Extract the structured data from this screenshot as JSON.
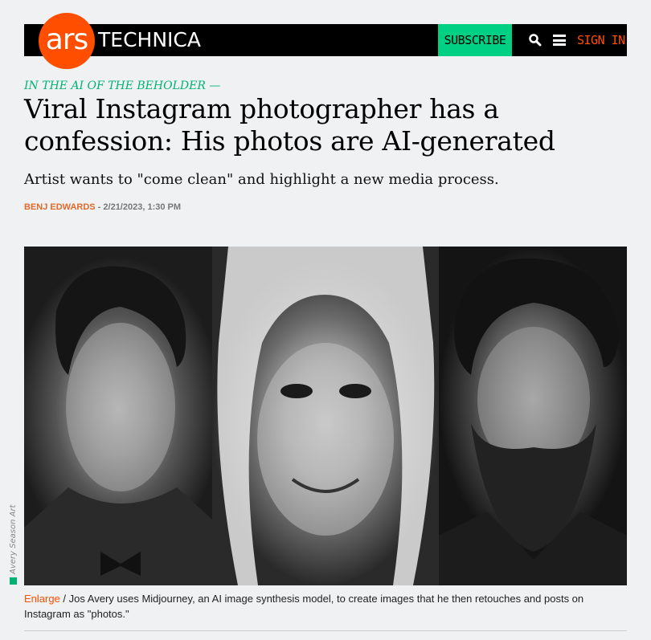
{
  "site": {
    "logo_ars": "ars",
    "logo_technica": "TECHNICA",
    "subscribe_label": "SUBSCRIBE",
    "signin_label": "SIGN IN",
    "icons": [
      "search-icon",
      "menu-icon"
    ],
    "accent_color": "#ff4e00",
    "subscribe_color": "#00d084"
  },
  "article": {
    "kicker": "IN THE AI OF THE BEHOLDER —",
    "headline": "Viral Instagram photographer has a confession: His photos are AI-generated",
    "dek": "Artist wants to \"come clean\" and highlight a new media process.",
    "author": "BENJ EDWARDS",
    "date": " - 2/21/2023, 1:30 PM"
  },
  "figure": {
    "credit": "Avery Season Art",
    "enlarge_label": "Enlarge",
    "caption": " / Jos Avery uses Midjourney, an AI image synthesis model, to create images that he then retouches and posts on Instagram as \"photos.\""
  }
}
